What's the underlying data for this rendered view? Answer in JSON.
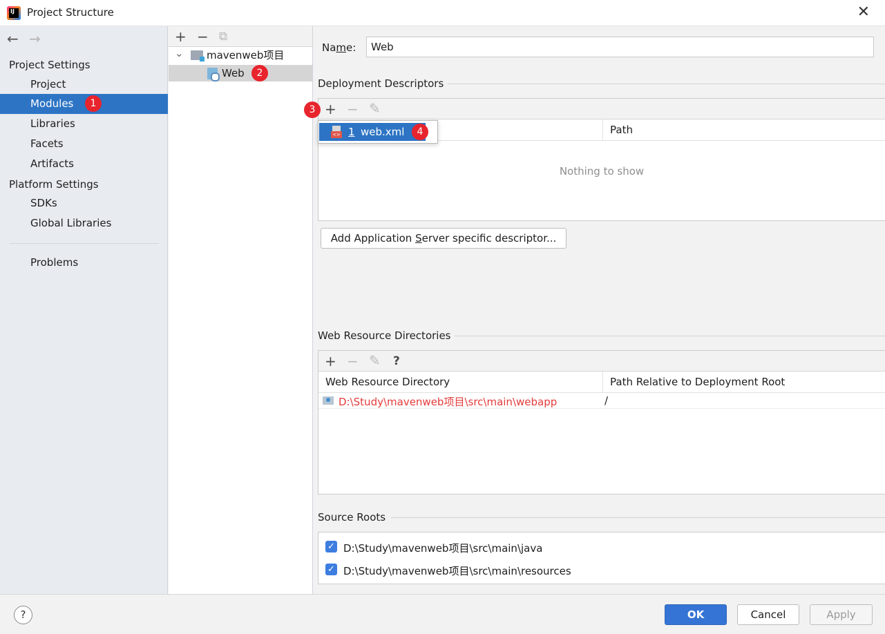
{
  "window": {
    "title": "Project Structure",
    "close": "✕"
  },
  "nav": {
    "back": "←",
    "forward": "→"
  },
  "sidebar": {
    "project_settings_title": "Project Settings",
    "items": [
      "Project",
      "Modules",
      "Libraries",
      "Facets",
      "Artifacts"
    ],
    "platform_settings_title": "Platform Settings",
    "platform_items": [
      "SDKs",
      "Global Libraries"
    ],
    "problems": "Problems",
    "selected": "Modules"
  },
  "badges": [
    "1",
    "2",
    "3",
    "4"
  ],
  "tree": {
    "toolbar": {
      "add": "+",
      "remove": "−",
      "copy": "⧉"
    },
    "root": "mavenweb项目",
    "child": "Web",
    "expand": "⌄"
  },
  "details": {
    "name_label_pre": "Na",
    "name_label_u": "m",
    "name_label_post": "e:",
    "name_value": "Web",
    "deployment_title": "Deployment Descriptors",
    "dd_toolbar": {
      "add": "+",
      "remove": "−",
      "edit": "✎"
    },
    "dd_popup_num": "1",
    "dd_popup_item": "web.xml",
    "dd_col_path": "Path",
    "dd_empty": "Nothing to show",
    "add_server_btn_pre": "Add Application ",
    "add_server_btn_u": "S",
    "add_server_btn_post": "erver specific descriptor...",
    "web_res_title": "Web Resource Directories",
    "wr_toolbar": {
      "add": "+",
      "remove": "−",
      "edit": "✎",
      "help": "?"
    },
    "wr_col1": "Web Resource Directory",
    "wr_col2": "Path Relative to Deployment Root",
    "wr_row_dir": "D:\\Study\\mavenweb项目\\src\\main\\webapp",
    "wr_row_rel": "/",
    "source_roots_title": "Source Roots",
    "source_roots": [
      "D:\\Study\\mavenweb项目\\src\\main\\java",
      "D:\\Study\\mavenweb项目\\src\\main\\resources"
    ]
  },
  "footer": {
    "help": "?",
    "ok": "OK",
    "cancel": "Cancel",
    "apply": "Apply"
  },
  "colors": {
    "selection": "#2d74c4",
    "badge": "#e8242c",
    "error_path": "#e53b3b",
    "primary_button": "#3574d4"
  }
}
